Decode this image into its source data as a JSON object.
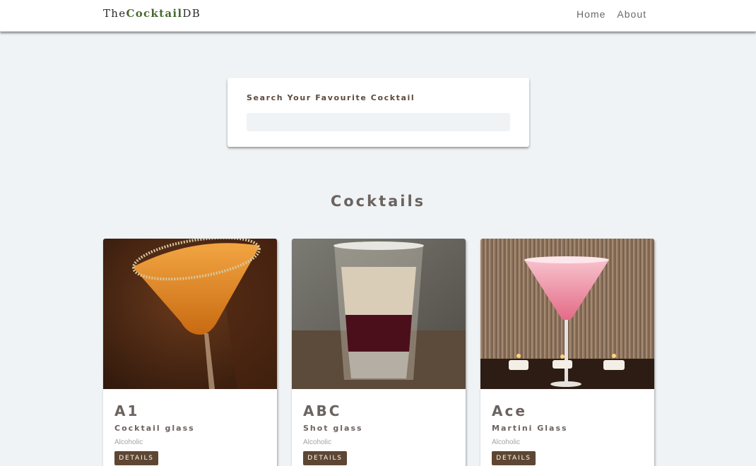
{
  "navbar": {
    "logo_prefix": "The",
    "logo_accent": "Cocktail",
    "logo_suffix": "DB",
    "links": [
      {
        "label": "Home"
      },
      {
        "label": "About"
      }
    ]
  },
  "search": {
    "label": "Search Your Favourite Cocktail",
    "value": "",
    "placeholder": ""
  },
  "section": {
    "title": "Cocktails"
  },
  "cocktails": [
    {
      "name": "A1",
      "glass": "Cocktail glass",
      "type": "Alcoholic",
      "button": "DETAILS"
    },
    {
      "name": "ABC",
      "glass": "Shot glass",
      "type": "Alcoholic",
      "button": "DETAILS"
    },
    {
      "name": "Ace",
      "glass": "Martini Glass",
      "type": "Alcoholic",
      "button": "DETAILS"
    }
  ],
  "colors": {
    "background": "#f0f3f5",
    "logo_accent": "#476a30",
    "button": "#5e4632",
    "heading": "#6b6360"
  }
}
